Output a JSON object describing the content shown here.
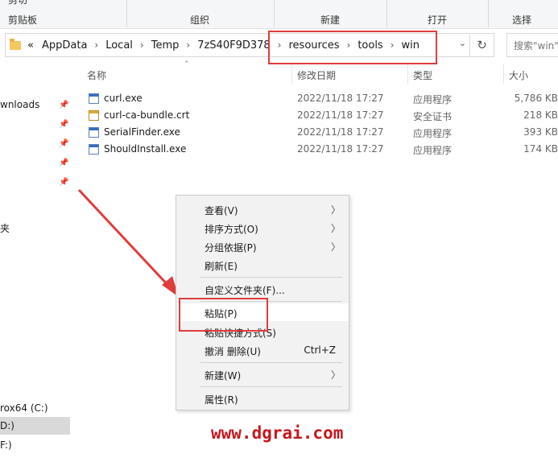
{
  "ribbon": {
    "cut_label": "剪切",
    "groups": [
      "剪贴板",
      "组织",
      "新建",
      "打开",
      "选择"
    ],
    "open_button": "打开"
  },
  "address": {
    "overflow": "«",
    "crumbs": [
      "AppData",
      "Local",
      "Temp",
      "7zS40F9D378",
      "resources",
      "tools",
      "win"
    ],
    "search_placeholder": "搜索\"win\""
  },
  "nav": {
    "items": [
      "wnloads",
      "夹",
      "rox64 (C:)",
      "D:)",
      "F:)"
    ]
  },
  "columns": {
    "name": "名称",
    "date": "修改日期",
    "type": "类型",
    "size": "大小"
  },
  "files": [
    {
      "name": "curl.exe",
      "date": "2022/11/18 17:27",
      "type": "应用程序",
      "size": "5,786 KB",
      "icon": "exe-icon"
    },
    {
      "name": "curl-ca-bundle.crt",
      "date": "2022/11/18 17:27",
      "type": "安全证书",
      "size": "218 KB",
      "icon": "certificate-icon"
    },
    {
      "name": "SerialFinder.exe",
      "date": "2022/11/18 17:27",
      "type": "应用程序",
      "size": "393 KB",
      "icon": "exe-icon"
    },
    {
      "name": "ShouldInstall.exe",
      "date": "2022/11/18 17:27",
      "type": "应用程序",
      "size": "174 KB",
      "icon": "exe-icon"
    }
  ],
  "menu": {
    "view": "查看(V)",
    "sort": "排序方式(O)",
    "group": "分组依据(P)",
    "refresh": "刷新(E)",
    "customize": "自定义文件夹(F)...",
    "paste": "粘贴(P)",
    "paste_shortcut": "粘贴快捷方式(S)",
    "undo": "撤消 删除(U)",
    "undo_key": "Ctrl+Z",
    "new": "新建(W)",
    "properties": "属性(R)"
  },
  "watermark": "www.dgrai.com",
  "colors": {
    "highlight": "#e03c3c",
    "watermark": "#c2191f",
    "menu_bg": "#f2f2f2"
  }
}
